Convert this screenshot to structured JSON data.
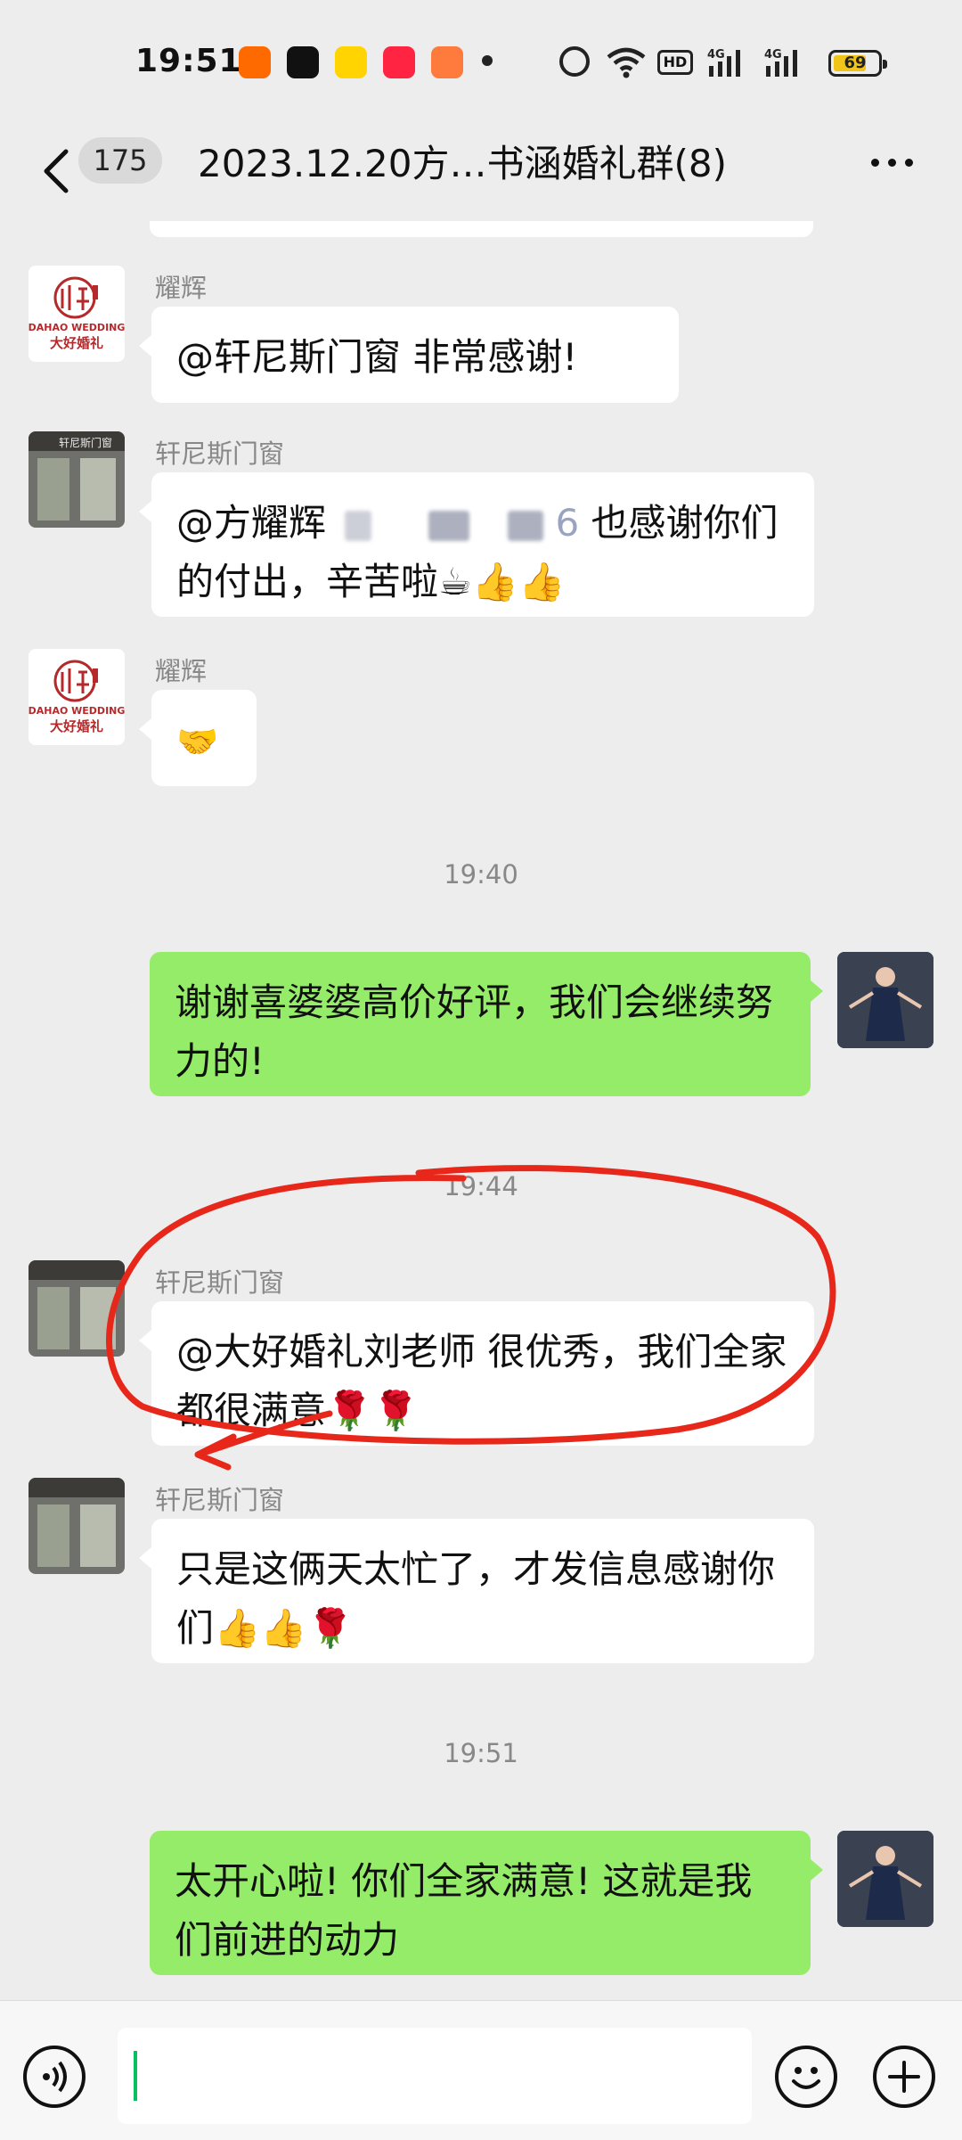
{
  "status_bar": {
    "time": "19:51",
    "app_icons": [
      "taobao-icon",
      "tiktok-icon",
      "xianyu-icon",
      "xiaohongshu-icon",
      "reader-icon"
    ],
    "network": "4G",
    "hd_label": "HD",
    "battery_level": "69"
  },
  "header": {
    "unread_count": "175",
    "title": "2023.12.20方…书涵婚礼群(8)"
  },
  "messages": [
    {
      "type": "incoming",
      "sender": "耀辉",
      "avatar": "dahao-wedding-logo",
      "text": "@轩尼斯门窗  非常感谢!"
    },
    {
      "type": "incoming",
      "sender": "轩尼斯门窗",
      "avatar": "store-photo",
      "text_before": "@方耀辉",
      "text_visible_tail": "6",
      "text_after": "也感谢你们的付出，辛苦啦☕👍👍"
    },
    {
      "type": "incoming",
      "sender": "耀辉",
      "avatar": "dahao-wedding-logo",
      "text": "🤝"
    },
    {
      "type": "time",
      "text": "19:40"
    },
    {
      "type": "outgoing",
      "avatar": "bride-photo",
      "text": "谢谢喜婆婆高价好评，我们会继续努力的!"
    },
    {
      "type": "time",
      "text": "19:44"
    },
    {
      "type": "incoming",
      "sender": "轩尼斯门窗",
      "avatar": "store-photo",
      "text": "@大好婚礼刘老师  很优秀，我们全家都很满意🌹🌹"
    },
    {
      "type": "incoming",
      "sender": "轩尼斯门窗",
      "avatar": "store-photo",
      "text": "只是这俩天太忙了，才发信息感谢你们👍👍🌹"
    },
    {
      "type": "time",
      "text": "19:51"
    },
    {
      "type": "outgoing",
      "avatar": "bride-photo",
      "text": "太开心啦! 你们全家满意! 这就是我们前进的动力"
    }
  ],
  "logo": {
    "latin": "DAHAO WEDDING",
    "cn": "大好婚礼"
  },
  "colors": {
    "bubble_out": "#95ec69",
    "bubble_in": "#ffffff",
    "background": "#ededed",
    "annotation": "#e8271b"
  }
}
